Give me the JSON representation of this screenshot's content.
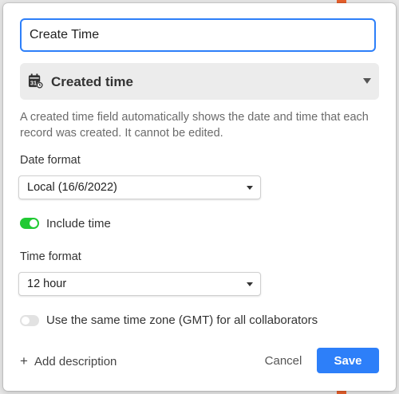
{
  "field": {
    "name_value": "Create Time",
    "type_label": "Created time",
    "type_icon": "calendar-clock-icon",
    "description": "A created time field automatically shows the date and time that each record was created. It cannot be edited."
  },
  "date_format": {
    "label": "Date format",
    "selected": "Local (16/6/2022)"
  },
  "include_time": {
    "label": "Include time",
    "enabled": true
  },
  "time_format": {
    "label": "Time format",
    "selected": "12 hour"
  },
  "same_time_zone": {
    "label": "Use the same time zone (GMT) for all collaborators",
    "enabled": false
  },
  "footer": {
    "add_description_icon": "+",
    "add_description_label": "Add description",
    "cancel_label": "Cancel",
    "save_label": "Save"
  },
  "colors": {
    "accent": "#2d7ff9",
    "toggle_on": "#20c933",
    "toggle_off": "#e2e2e2",
    "edge_orange": "#e8602c"
  }
}
